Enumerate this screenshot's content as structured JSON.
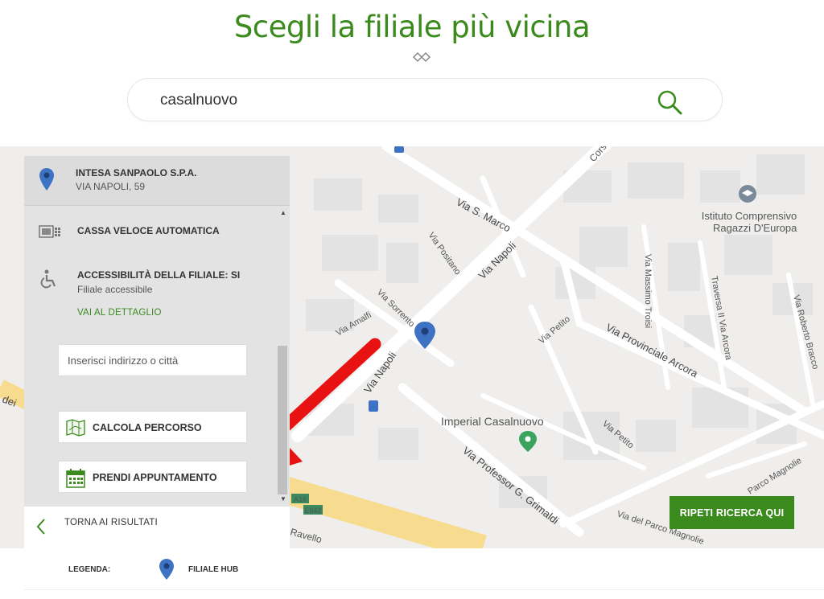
{
  "page": {
    "title": "Scegli la filiale più vicina"
  },
  "search": {
    "value": "casalnuovo"
  },
  "branch": {
    "name": "INTESA SANPAOLO S.P.A.",
    "address": "VIA NAPOLI, 59"
  },
  "features": [
    {
      "icon": "atm-icon",
      "title": "CASSA VELOCE AUTOMATICA"
    },
    {
      "icon": "wheelchair-icon",
      "title": "ACCESSIBILITÀ DELLA FILIALE: SI",
      "subtitle": "Filiale accessibile"
    }
  ],
  "detail_link": "VAI AL DETTAGLIO",
  "route": {
    "placeholder": "Inserisci indirizzo o città",
    "calc_label": "CALCOLA PERCORSO",
    "appointment_label": "PRENDI APPUNTAMENTO"
  },
  "back_label": "TORNA AI RISULTATI",
  "repeat_search_label": "RIPETI RICERCA QUI",
  "legend": {
    "label": "LEGENDA:",
    "item": "FILIALE HUB"
  },
  "map": {
    "streets": [
      "Via S. Marco",
      "Via Napoli",
      "Via Positano",
      "Via Sorrento",
      "Via Amalfi",
      "Via Petito",
      "Via Provinciale Arcora",
      "Via Massimo Troisi",
      "Traversa II Via Arcora",
      "Via Roberto Bracco",
      "Via Professor G. Grimaldi",
      "Via del Parco Magnolie",
      "Parco Magnolie",
      "Ravello",
      "Corso"
    ],
    "pois": [
      "Istituto Comprensivo Ragazzi D'Europa",
      "Imperial Casalnuovo"
    ],
    "road_signs": [
      "A16",
      "E842"
    ],
    "edge_text": "dei"
  },
  "colors": {
    "brand_green": "#3a8a1e",
    "pin_blue": "#3e73c4",
    "arrow_red": "#e81212"
  }
}
